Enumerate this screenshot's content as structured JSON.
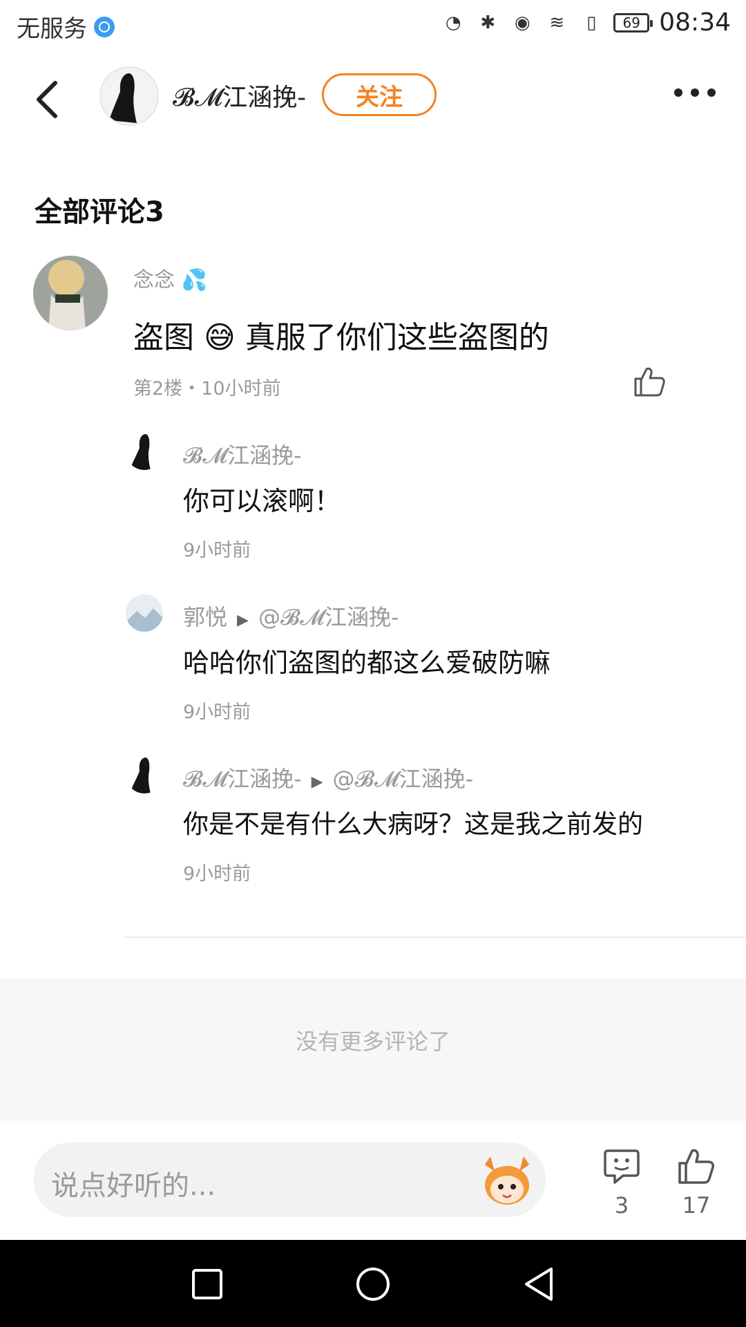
{
  "status_bar": {
    "carrier": "无服务",
    "battery": "69",
    "time": "08:34"
  },
  "header": {
    "author": "𝓑𝓜江涵挽-",
    "follow_label": "关注"
  },
  "section": {
    "title": "全部评论3"
  },
  "comment": {
    "user": "念念",
    "text": "盗图 😅 真服了你们这些盗图的",
    "meta": "第2楼・10小时前"
  },
  "replies": [
    {
      "user": "𝓑𝓜江涵挽-",
      "reply_to": "",
      "text": "你可以滚啊！",
      "time": "9小时前"
    },
    {
      "user": "郭悦",
      "reply_to": "@𝓑𝓜江涵挽-",
      "text": "哈哈你们盗图的都这么爱破防嘛",
      "time": "9小时前"
    },
    {
      "user": "𝓑𝓜江涵挽-",
      "reply_to": "@𝓑𝓜江涵挽-",
      "text": "你是不是有什么大病呀？这是我之前发的",
      "time": "9小时前"
    }
  ],
  "footer": {
    "no_more": "没有更多评论了"
  },
  "bottom_bar": {
    "input_placeholder": "说点好听的...",
    "comment_count": "3",
    "like_count": "17"
  },
  "icons": {
    "back": "back-arrow-icon",
    "more": "more-icon",
    "like": "thumb-up-icon",
    "comment": "comment-bubble-icon",
    "mascot": "mascot-emoji-icon"
  },
  "colors": {
    "accent": "#f58220",
    "secondary_text": "#9a9a9a",
    "background": "#ffffff"
  }
}
